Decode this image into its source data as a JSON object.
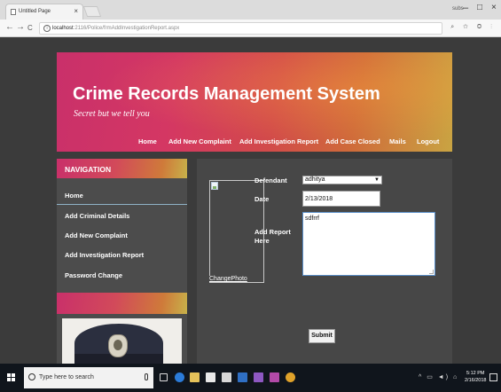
{
  "browser": {
    "tab_title": "Untitled Page",
    "tab_close": "×",
    "user_label": "subs",
    "window_controls": {
      "minimize": "–",
      "maximize": "□",
      "close": "×"
    },
    "nav": {
      "back": "←",
      "forward": "→",
      "reload": "C"
    },
    "url_host": "localhost",
    "url_path": ":2116/Police/frmAddInvestigationReport.aspx",
    "addr_icons": "⌕ ☆ ◎ ⋮"
  },
  "header": {
    "title": "Crime Records Management System",
    "tagline": "Secret but we tell you",
    "nav": [
      "Home",
      "Add New Complaint",
      "Add Investigation Report",
      "Add Case Closed",
      "Mails",
      "Logout"
    ]
  },
  "sidebar": {
    "heading": "NAVIGATION",
    "items": [
      "Home",
      "Add Criminal Details",
      "Add New Complaint",
      "Add Investigation Report",
      "Password Change"
    ]
  },
  "form": {
    "change_photo": "ChangePhoto",
    "defendant_label": "Defendant",
    "defendant_value": "adhitya",
    "date_label": "Date",
    "date_value": "2/13/2018",
    "report_label": "Add Report Here",
    "report_value": "sdfrrf",
    "submit_label": "Submit"
  },
  "taskbar": {
    "search_placeholder": "Type here to search",
    "tray_icons": "^ ▭ ◄) ⌂",
    "clock_time": "5:12 PM",
    "clock_date": "2/16/2018"
  },
  "colors": {
    "page_bg": "#3b3b3b",
    "header_gradient_start": "#c9306a",
    "header_gradient_end": "#c9a442",
    "taskbar_bg": "#10151c"
  }
}
